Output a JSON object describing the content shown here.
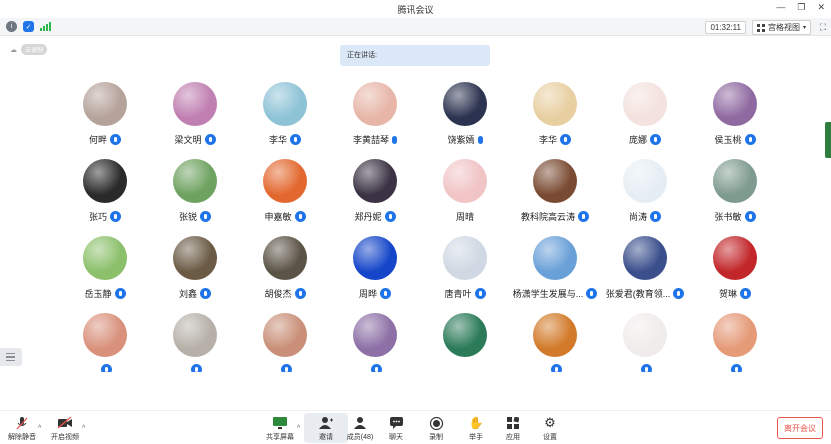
{
  "window": {
    "title": "腾讯会议"
  },
  "topbar": {
    "timer": "01:32:11",
    "view_label": "宫格视图"
  },
  "cloud": {
    "label": "云录制"
  },
  "speaking": {
    "label": "正在讲话:"
  },
  "participants": [
    {
      "name": "何畔",
      "mic": "badge",
      "color": "#b5a29a"
    },
    {
      "name": "梁文明",
      "mic": "badge",
      "color": "#c07fb1"
    },
    {
      "name": "李华",
      "mic": "badge",
      "color": "#8ec3d6"
    },
    {
      "name": "李黄喆琴",
      "mic": "plain",
      "color": "#e7b6a8"
    },
    {
      "name": "饶紫嫣",
      "mic": "plain",
      "color": "#2c3350"
    },
    {
      "name": "李华",
      "mic": "badge",
      "color": "#e8cfa1"
    },
    {
      "name": "庞娜",
      "mic": "badge",
      "color": "#f3e2de"
    },
    {
      "name": "侯玉桃",
      "mic": "badge",
      "color": "#8f6aa1"
    },
    {
      "name": "张巧",
      "mic": "badge",
      "color": "#2a2a2a"
    },
    {
      "name": "张锐",
      "mic": "badge",
      "color": "#6ea260"
    },
    {
      "name": "申嘉敏",
      "mic": "badge",
      "color": "#e3682f"
    },
    {
      "name": "郑丹妮",
      "mic": "badge",
      "color": "#3b3344"
    },
    {
      "name": "周晴",
      "mic": "none",
      "color": "#f1c4c6"
    },
    {
      "name": "教科院高云涛",
      "mic": "badge",
      "color": "#7a4b33"
    },
    {
      "name": "尚涛",
      "mic": "badge",
      "color": "#e6eef4"
    },
    {
      "name": "张书敏",
      "mic": "badge",
      "color": "#7f9b8f"
    },
    {
      "name": "岳玉静",
      "mic": "badge",
      "color": "#8cc06b"
    },
    {
      "name": "刘鑫",
      "mic": "badge",
      "color": "#6b5b45"
    },
    {
      "name": "胡俊杰",
      "mic": "badge",
      "color": "#5b5346"
    },
    {
      "name": "周晔",
      "mic": "badge",
      "color": "#1546c9"
    },
    {
      "name": "唐青叶",
      "mic": "badge",
      "color": "#cfd8e3"
    },
    {
      "name": "杨潇学生发展与...",
      "mic": "badge",
      "color": "#6aa0d8"
    },
    {
      "name": "张爱君(教育领...",
      "mic": "badge",
      "color": "#3a4f8c"
    },
    {
      "name": "贺琳",
      "mic": "badge",
      "color": "#c2262a"
    },
    {
      "name": "",
      "mic": "badge",
      "color": "#d9917c"
    },
    {
      "name": "",
      "mic": "badge",
      "color": "#b6b0a8"
    },
    {
      "name": "",
      "mic": "badge",
      "color": "#c98f78"
    },
    {
      "name": "",
      "mic": "badge",
      "color": "#8d70a6"
    },
    {
      "name": "",
      "mic": "none",
      "color": "#2b7a58"
    },
    {
      "name": "",
      "mic": "badge",
      "color": "#d27a2a"
    },
    {
      "name": "",
      "mic": "badge",
      "color": "#f1ecec"
    },
    {
      "name": "",
      "mic": "badge",
      "color": "#e59a78"
    }
  ],
  "toolbar": {
    "unmute": "解除静音",
    "video": "开启视频",
    "share": "共享屏幕",
    "invite": "邀请",
    "members": "成员(48)",
    "chat": "聊天",
    "record": "录制",
    "raise_hand": "举手",
    "apps": "应用",
    "settings": "设置",
    "leave": "离开会议"
  }
}
